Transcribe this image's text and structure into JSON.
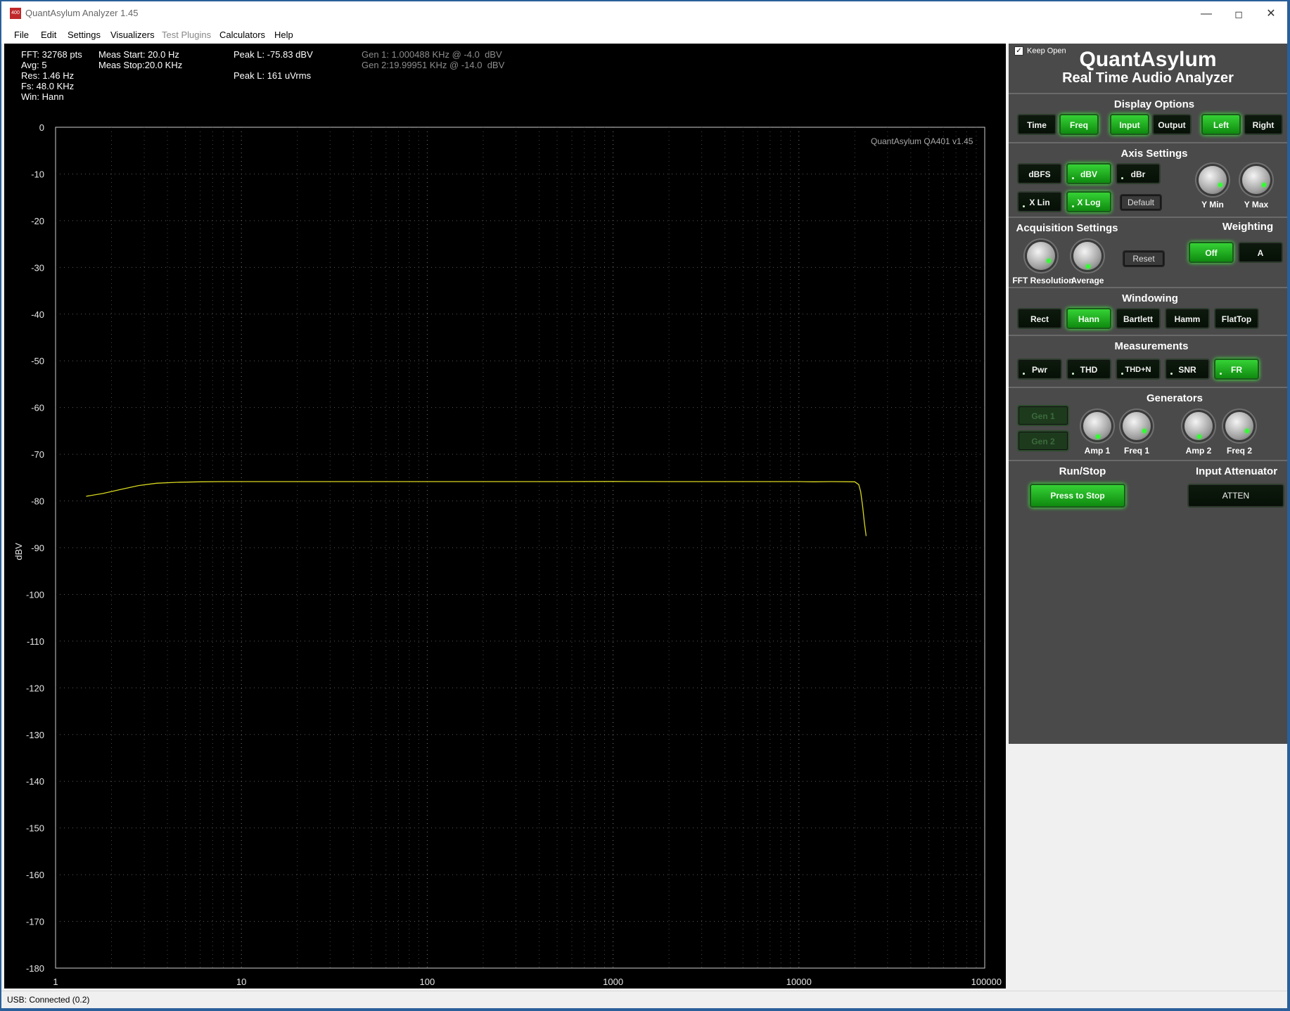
{
  "window": {
    "title": "QuantAsylum Analyzer 1.45",
    "icon": "app-icon",
    "icon_text": "400"
  },
  "menu": [
    "File",
    "Edit",
    "Settings",
    "Visualizers",
    "Test Plugins",
    "Calculators",
    "Help"
  ],
  "info": {
    "fft": "FFT: 32768 pts",
    "avg": "Avg: 5",
    "res": "Res: 1.46 Hz",
    "fs": "Fs: 48.0 KHz",
    "win": "Win: Hann",
    "meas_start": "Meas Start: 20.0 Hz",
    "meas_stop": "Meas Stop:20.0 KHz",
    "peak_dbv": "Peak L: -75.83 dBV",
    "peak_uv": "Peak L: 161 uVrms",
    "gen1": "Gen 1: 1.000488 KHz @ -4.0  dBV",
    "gen2": "Gen 2:19.99951 KHz @ -14.0  dBV"
  },
  "chart_data": {
    "type": "line",
    "watermark": "QuantAsylum QA401 v1.45",
    "ylabel": "dBV",
    "xlabel": "",
    "xscale": "log",
    "xlim": [
      1,
      100000
    ],
    "ylim": [
      -180,
      0
    ],
    "x_ticks": [
      "1",
      "10",
      "100",
      "1000",
      "10000",
      "100000"
    ],
    "y_ticks": [
      "0",
      "-10",
      "-20",
      "-30",
      "-40",
      "-50",
      "-60",
      "-70",
      "-80",
      "-90",
      "-100",
      "-110",
      "-120",
      "-130",
      "-140",
      "-150",
      "-160",
      "-170",
      "-180"
    ],
    "grid": true,
    "series": [
      {
        "color": "#d8d820",
        "x": [
          1.46,
          1.8,
          2.2,
          2.8,
          3.5,
          4.5,
          6,
          8,
          10,
          20,
          50,
          100,
          200,
          500,
          1000,
          2000,
          5000,
          10000,
          12000,
          15000,
          20000,
          21000,
          21500,
          22000,
          22500,
          23000
        ],
        "y": [
          -79,
          -78.4,
          -77.6,
          -76.7,
          -76.2,
          -76.0,
          -75.9,
          -75.85,
          -75.85,
          -75.85,
          -75.85,
          -75.85,
          -75.85,
          -75.85,
          -75.83,
          -75.85,
          -75.85,
          -75.85,
          -75.9,
          -75.85,
          -75.9,
          -76.5,
          -78,
          -81,
          -84.5,
          -87.5
        ]
      }
    ]
  },
  "status": {
    "text": "USB: Connected  (0.2)"
  },
  "panel": {
    "keep_open": "Keep Open",
    "brand_title": "QuantAsylum",
    "brand_subtitle": "Real Time Audio Analyzer",
    "display_options": {
      "title": "Display Options",
      "time": "Time",
      "freq": "Freq",
      "input": "Input",
      "output": "Output",
      "left": "Left",
      "right": "Right"
    },
    "axis_settings": {
      "title": "Axis Settings",
      "dbfs": "dBFS",
      "dbv": "dBV",
      "dbr": "dBr",
      "xlin": "X Lin",
      "xlog": "X Log",
      "default": "Default",
      "ymin": "Y Min",
      "ymax": "Y Max"
    },
    "acquisition": {
      "title": "Acquisition Settings",
      "fft_res": "FFT Resolution",
      "average": "Average",
      "reset": "Reset"
    },
    "weighting": {
      "title": "Weighting",
      "off": "Off",
      "a": "A"
    },
    "windowing": {
      "title": "Windowing",
      "rect": "Rect",
      "hann": "Hann",
      "bartlett": "Bartlett",
      "hamm": "Hamm",
      "flattop": "FlatTop"
    },
    "measurements": {
      "title": "Measurements",
      "pwr": "Pwr",
      "thd": "THD",
      "thdn": "THD+N",
      "snr": "SNR",
      "fr": "FR"
    },
    "generators": {
      "title": "Generators",
      "gen1": "Gen 1",
      "gen2": "Gen 2",
      "amp1": "Amp 1",
      "freq1": "Freq 1",
      "amp2": "Amp 2",
      "freq2": "Freq 2"
    },
    "runstop": {
      "title": "Run/Stop",
      "button": "Press to Stop"
    },
    "attenuator": {
      "title": "Input Attenuator",
      "button": "ATTEN"
    }
  },
  "colors": {
    "accent_green": "#30e030",
    "trace": "#d8d820",
    "plot_bg": "#000000",
    "panel_bg": "#4a4a4a"
  }
}
